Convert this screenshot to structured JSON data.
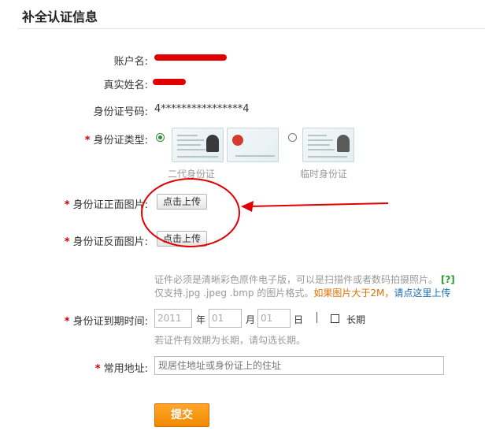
{
  "page": {
    "title": "补全认证信息"
  },
  "form": {
    "account_label": "账户名:",
    "realname_label": "真实姓名:",
    "id_number_label": "身份证号码:",
    "id_number_value": "4****************4",
    "id_type_label": "身份证类型:",
    "id_type_options": [
      {
        "label": "二代身份证",
        "selected": true
      },
      {
        "label": "临时身份证",
        "selected": false
      }
    ],
    "front_label": "身份证正面图片:",
    "back_label": "身份证反面图片:",
    "upload_button": "点击上传",
    "hint": {
      "line1": "证件必须是清晰彩色原件电子版，可以是扫描件或者数码拍摄照片。",
      "help": "[?]",
      "line2_start": "仅支持.jpg .jpeg .bmp 的图片格式。",
      "line2_warn": "如果图片大于2M，",
      "line2_link": "请点这里上传"
    },
    "expiry": {
      "label": "身份证到期时间:",
      "year_value": "2011",
      "year_unit": "年",
      "month_value": "01",
      "month_unit": "月",
      "day_value": "01",
      "day_unit": "日",
      "long_term_label": "长期",
      "hint": "若证件有效期为长期，请勾选长期。"
    },
    "address": {
      "label": "常用地址:",
      "placeholder": "现居住地址或身份证上的住址"
    },
    "submit_label": "提交"
  },
  "colors": {
    "required_mark": "#cc0000",
    "accent_orange": "#f08a00",
    "link_blue": "#1a6fae",
    "annotation_red": "#e00000"
  }
}
